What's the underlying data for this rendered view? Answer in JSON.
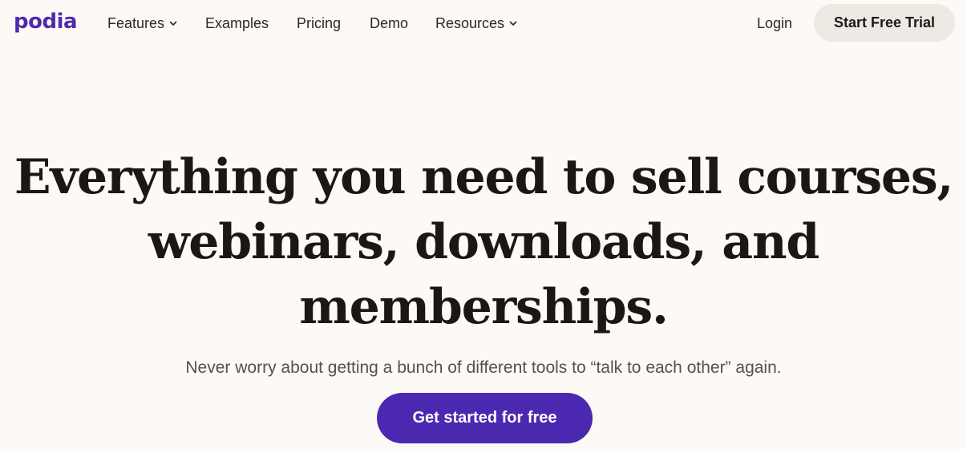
{
  "brand": {
    "logo_text": "podia",
    "accent_color": "#4b28b0"
  },
  "nav": {
    "items": [
      {
        "label": "Features",
        "has_dropdown": true,
        "icon": "chevron-down-icon"
      },
      {
        "label": "Examples",
        "has_dropdown": false
      },
      {
        "label": "Pricing",
        "has_dropdown": false
      },
      {
        "label": "Demo",
        "has_dropdown": false
      },
      {
        "label": "Resources",
        "has_dropdown": true,
        "icon": "chevron-down-icon"
      }
    ],
    "login_label": "Login",
    "trial_label": "Start Free Trial"
  },
  "hero": {
    "headline_lines": [
      "Everything you need to sell courses,",
      "webinars, downloads, and",
      "memberships."
    ],
    "subtext": "Never worry about getting a bunch of different tools to “talk to each other” again.",
    "cta_label": "Get started for free"
  }
}
